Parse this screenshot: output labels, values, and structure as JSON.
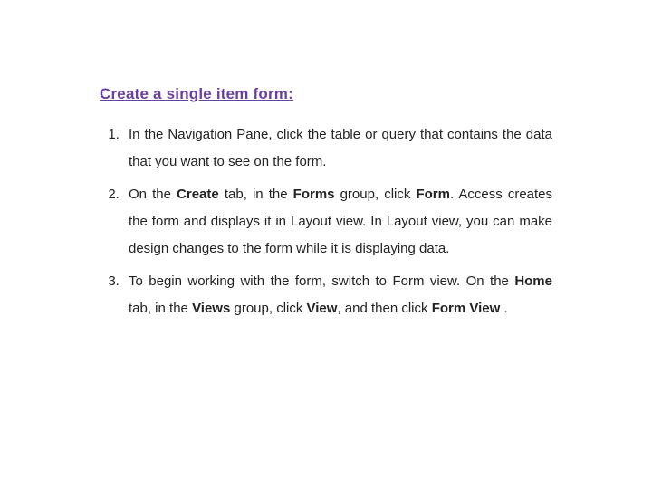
{
  "heading": "Create a single item form:",
  "steps": {
    "s1": "In the Navigation Pane, click the table or query that contains the data that you want to see on the form.",
    "s2a": "On the ",
    "s2_create": "Create",
    "s2b": " tab, in the ",
    "s2_forms": "Forms",
    "s2c": " group, click ",
    "s2_form": "Form",
    "s2d": ". Access creates the form and displays it in Layout view. In Layout view, you can make design changes to the form while it is displaying data.",
    "s3a": "To begin working with the form, switch to Form view. On the ",
    "s3_home": "Home",
    "s3b": " tab,  in  the ",
    "s3_views": "Views",
    "s3c": " group,  click ",
    "s3_view": "View",
    "s3d": ",  and  then click ",
    "s3_formview": "Form View",
    "s3e": "  ."
  }
}
